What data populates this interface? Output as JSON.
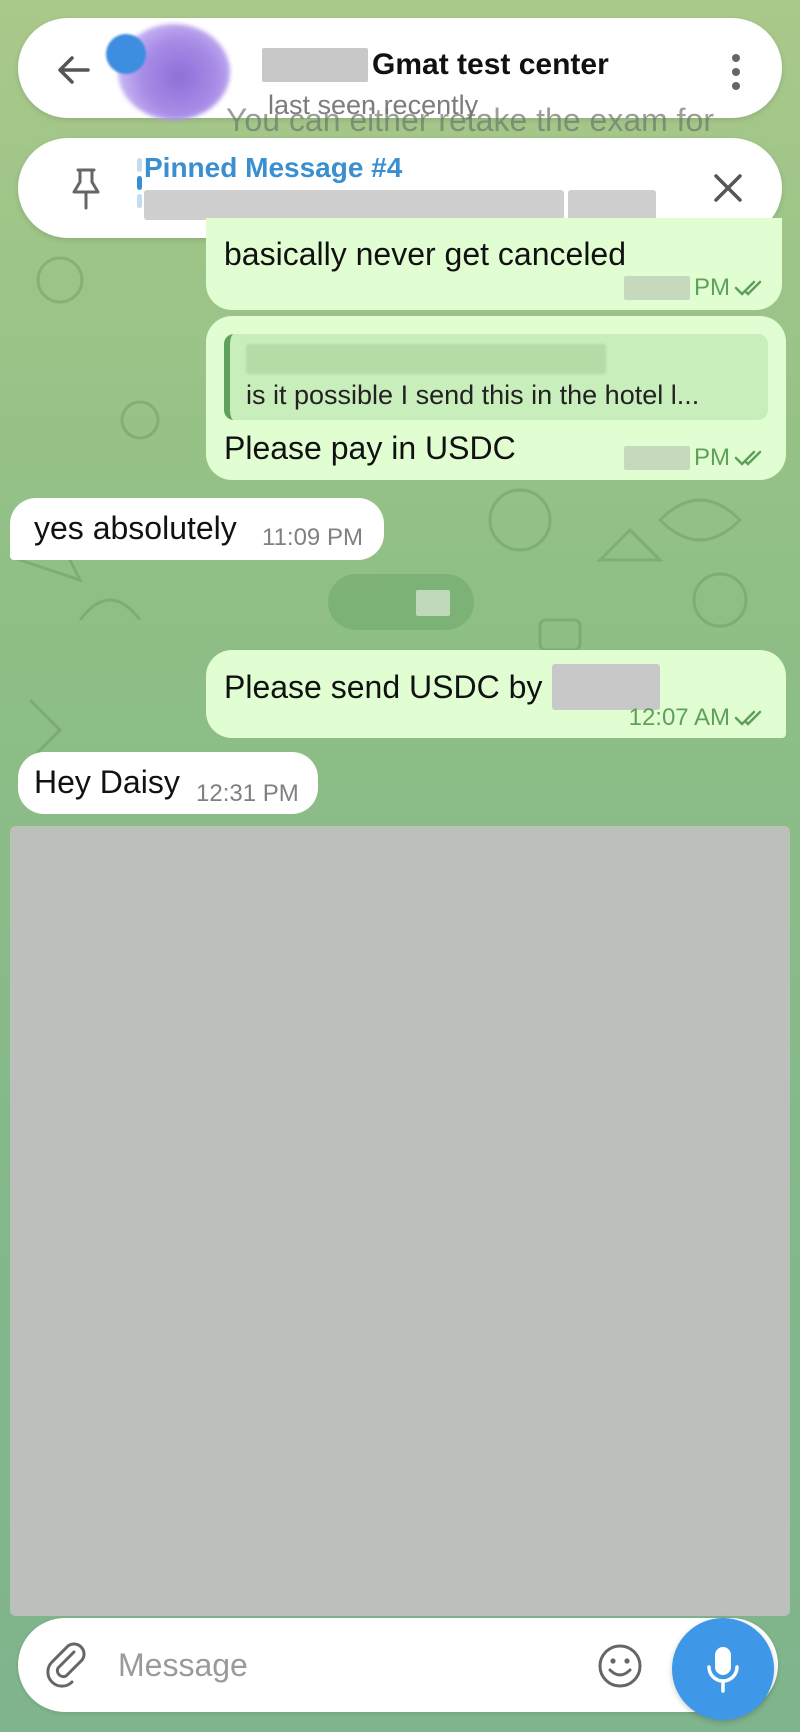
{
  "colors": {
    "accent": "#3a8fd0",
    "outgoing_bubble": "#e1fdd2",
    "incoming_bubble": "#ffffff",
    "timestamp_out": "#5fa05b",
    "mic_button": "#3f97e8"
  },
  "header": {
    "title": "Gmat test center",
    "status": "last seen recently"
  },
  "pinned": {
    "title": "Pinned Message #4"
  },
  "messages": {
    "m0": {
      "text": "You can either retake the exam for"
    },
    "m1": {
      "text": "basically never get canceled",
      "time_suffix": "PM"
    },
    "m2": {
      "reply_text": "is it possible I send this in the hotel l...",
      "text": "Please pay in USDC",
      "time_suffix": "PM"
    },
    "m3": {
      "text": "yes absolutely",
      "time": "11:09 PM"
    },
    "m4": {
      "text": "Please send USDC by",
      "time": "12:07 AM"
    },
    "m5": {
      "text": "Hey Daisy",
      "time": "12:31 PM"
    }
  },
  "composer": {
    "placeholder": "Message"
  },
  "icons": {
    "back": "arrow-left-icon",
    "menu": "more-vertical-icon",
    "pin": "pin-icon",
    "close": "close-icon",
    "attach": "paperclip-icon",
    "emoji": "smiley-icon",
    "mic": "microphone-icon",
    "read": "double-check-icon"
  }
}
